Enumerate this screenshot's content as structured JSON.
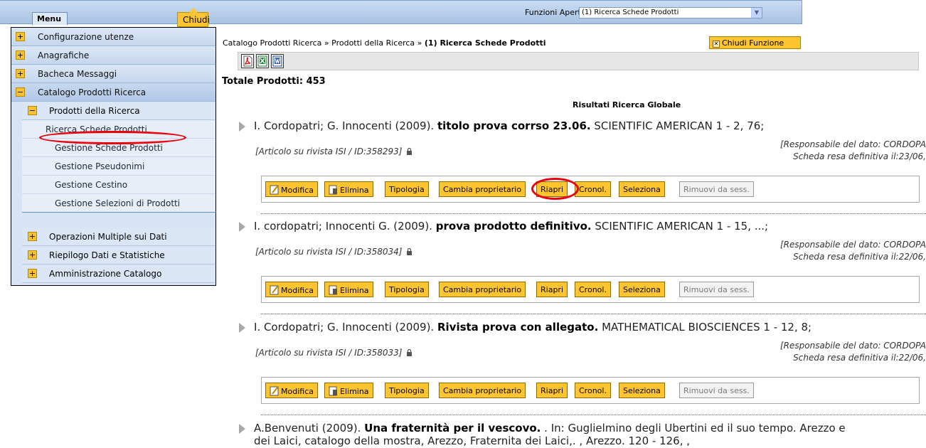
{
  "topbar": {
    "menu_label": "Menu",
    "close_tooltip": "Chiudi",
    "open_functions_label": "Funzioni Aperte:",
    "open_functions_value": "(1) Ricerca Schede Prodotti"
  },
  "sidebar": {
    "items": [
      {
        "label": "Configurazione utenze",
        "toggle": "+"
      },
      {
        "label": "Anagrafiche",
        "toggle": "+"
      },
      {
        "label": "Bacheca Messaggi",
        "toggle": "+"
      },
      {
        "label": "Catalogo Prodotti Ricerca",
        "toggle": "−"
      },
      {
        "label": "Prodotti della Ricerca",
        "toggle": "−"
      },
      {
        "label": "Ricerca Schede Prodotti"
      },
      {
        "label": "Gestione Schede Prodotti"
      },
      {
        "label": "Gestione Pseudonimi"
      },
      {
        "label": "Gestione Cestino"
      },
      {
        "label": "Gestione Selezioni di Prodotti"
      },
      {
        "label": "Operazioni Multiple sui Dati",
        "toggle": "+"
      },
      {
        "label": "Riepilogo Dati e Statistiche",
        "toggle": "+"
      },
      {
        "label": "Amministrazione Catalogo",
        "toggle": "+"
      }
    ]
  },
  "breadcrumb": {
    "part1": "Catalogo Prodotti Ricerca",
    "sep": "»",
    "part2": "Prodotti della Ricerca",
    "current": "(1) Ricerca Schede Prodotti"
  },
  "close_function_label": "Chiudi Funzione",
  "export_icons": [
    "pdf-icon",
    "excel-icon",
    "word-icon"
  ],
  "total_label": "Totale Prodotti: 453",
  "results_title": "Risultati Ricerca Globale",
  "actions": [
    "Modifica",
    "Elimina",
    "Tipologia",
    "Cambia proprietario",
    "Riapri",
    "Cronol.",
    "Seleziona",
    "Rimuovi da sess."
  ],
  "records": [
    {
      "authors": "I. Cordopatri; G. Innocenti (2009).",
      "title": "titolo prova corrso 23.06.",
      "source": "SCIENTIFIC AMERICAN 1 - 2, 76;",
      "type": "[Articolo su rivista ISI / ID:358293]",
      "responsible": "[Responsabile del dato: CORDOPA",
      "definitive": "Scheda resa definitiva il:23/06,"
    },
    {
      "authors": "I. cordopatri; Innocenti G. (2009).",
      "title": "prova prodotto definitivo.",
      "source": "SCIENTIFIC AMERICAN 1 - 15, ...;",
      "type": "[Articolo su rivista ISI / ID:358034]",
      "responsible": "[Responsabile del dato: CORDOPA",
      "definitive": "Scheda resa definitiva il:22/06,"
    },
    {
      "authors": "I. Cordopatri; G. Innocenti (2009).",
      "title": "Rivista prova con allegato.",
      "source": "MATHEMATICAL BIOSCIENCES 1 - 12, 8;",
      "type": "[Articolo su rivista ISI / ID:358033]",
      "responsible": "[Responsabile del dato: CORDOPA",
      "definitive": "Scheda resa definitiva il:22/06,"
    },
    {
      "authors": "A.Benvenuti (2009).",
      "title": "Una fraternità per il vescovo.",
      "source": ". In: Guglielmino degli Ubertini ed il suo tempo. Arezzo e",
      "line2": "dei Laici, catalogo della mostra, Arezzo, Fraternita dei Laici,. , Arezzo. 120 - 126, ,"
    }
  ],
  "colors": {
    "button": "#ffc530",
    "menu_bg": "#d6e4f5",
    "highlight_ellipse": "#e8000d"
  }
}
